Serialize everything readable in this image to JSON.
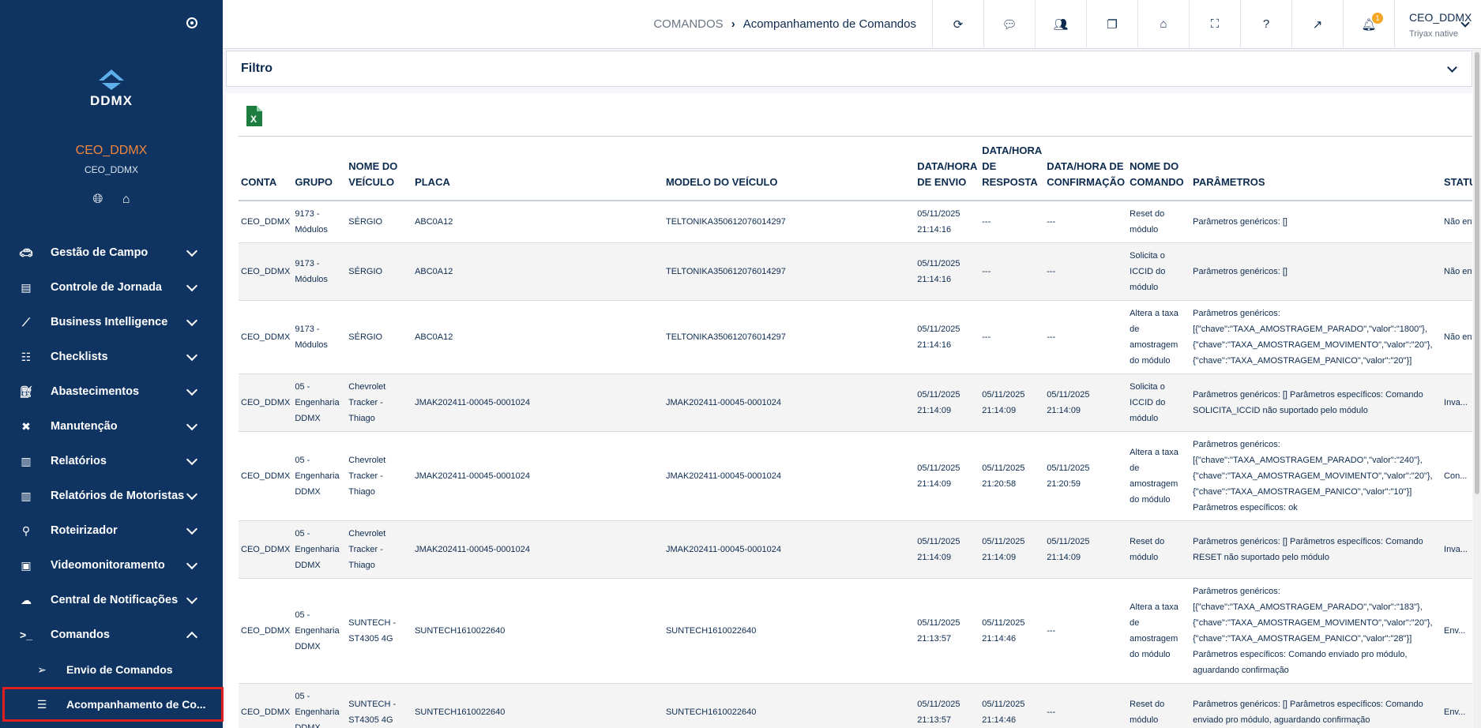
{
  "sidebar": {
    "logo_text": "DDMX",
    "user_name": "CEO_DDMX",
    "user_sub": "CEO_DDMX",
    "menu": [
      {
        "label": "Gestão de Campo",
        "icon": "car-icon"
      },
      {
        "label": "Controle de Jornada",
        "icon": "id-card-icon"
      },
      {
        "label": "Business Intelligence",
        "icon": "chart-line-icon"
      },
      {
        "label": "Checklists",
        "icon": "checklist-icon"
      },
      {
        "label": "Abastecimentos",
        "icon": "fuel-icon"
      },
      {
        "label": "Manutenção",
        "icon": "tools-icon"
      },
      {
        "label": "Relatórios",
        "icon": "report-icon"
      },
      {
        "label": "Relatórios de Motoristas",
        "icon": "driver-report-icon"
      },
      {
        "label": "Roteirizador",
        "icon": "route-icon"
      },
      {
        "label": "Videomonitoramento",
        "icon": "video-icon"
      },
      {
        "label": "Central de Notificações",
        "icon": "notification-car-icon"
      },
      {
        "label": "Comandos",
        "icon": "terminal-icon"
      }
    ],
    "submenu": [
      {
        "label": "Envio de Comandos",
        "icon": "send-icon"
      },
      {
        "label": "Acompanhamento de Co...",
        "icon": "list-check-icon"
      }
    ]
  },
  "topbar": {
    "breadcrumb_root": "COMANDOS",
    "breadcrumb_current": "Acompanhamento de Comandos",
    "notification_count": "1",
    "user_name": "CEO_DDMX",
    "user_sub": "Triyax native"
  },
  "filter": {
    "title": "Filtro"
  },
  "table": {
    "headers": [
      "CONTA",
      "GRUPO",
      "NOME DO VEÍCULO",
      "PLACA",
      "MODELO DO VEÍCULO",
      "DATA/HORA DE ENVIO",
      "DATA/HORA DE RESPOSTA",
      "DATA/HORA DE CONFIRMAÇÃO",
      "NOME DO COMANDO",
      "PARÂMETROS",
      "STATUS ATUAL"
    ],
    "rows": [
      [
        "CEO_DDMX",
        "9173 - Módulos",
        "SÉRGIO",
        "ABC0A12",
        "TELTONIKA350612076014297",
        "05/11/2025 21:14:16",
        "---",
        "---",
        "Reset do módulo",
        "Parâmetros genéricos: []",
        "Não env..."
      ],
      [
        "CEO_DDMX",
        "9173 - Módulos",
        "SÉRGIO",
        "ABC0A12",
        "TELTONIKA350612076014297",
        "05/11/2025 21:14:16",
        "---",
        "---",
        "Solicita o ICCID do módulo",
        "Parâmetros genéricos: []",
        "Não env..."
      ],
      [
        "CEO_DDMX",
        "9173 - Módulos",
        "SÉRGIO",
        "ABC0A12",
        "TELTONIKA350612076014297",
        "05/11/2025 21:14:16",
        "---",
        "---",
        "Altera a taxa de amostragem do módulo",
        "Parâmetros genéricos: [{\"chave\":\"TAXA_AMOSTRAGEM_PARADO\",\"valor\":\"1800\"}, {\"chave\":\"TAXA_AMOSTRAGEM_MOVIMENTO\",\"valor\":\"20\"}, {\"chave\":\"TAXA_AMOSTRAGEM_PANICO\",\"valor\":\"20\"}]",
        "Não env..."
      ],
      [
        "CEO_DDMX",
        "05 - Engenharia DDMX",
        "Chevrolet Tracker - Thiago",
        "JMAK202411-00045-0001024",
        "JMAK202411-00045-0001024",
        "05/11/2025 21:14:09",
        "05/11/2025 21:14:09",
        "05/11/2025 21:14:09",
        "Solicita o ICCID do módulo",
        "Parâmetros genéricos: [] Parâmetros específicos: Comando SOLICITA_ICCID não suportado pelo módulo",
        "Inva..."
      ],
      [
        "CEO_DDMX",
        "05 - Engenharia DDMX",
        "Chevrolet Tracker - Thiago",
        "JMAK202411-00045-0001024",
        "JMAK202411-00045-0001024",
        "05/11/2025 21:14:09",
        "05/11/2025 21:20:58",
        "05/11/2025 21:20:59",
        "Altera a taxa de amostragem do módulo",
        "Parâmetros genéricos: [{\"chave\":\"TAXA_AMOSTRAGEM_PARADO\",\"valor\":\"240\"}, {\"chave\":\"TAXA_AMOSTRAGEM_MOVIMENTO\",\"valor\":\"20\"}, {\"chave\":\"TAXA_AMOSTRAGEM_PANICO\",\"valor\":\"10\"}] Parâmetros específicos: ok",
        "Con..."
      ],
      [
        "CEO_DDMX",
        "05 - Engenharia DDMX",
        "Chevrolet Tracker - Thiago",
        "JMAK202411-00045-0001024",
        "JMAK202411-00045-0001024",
        "05/11/2025 21:14:09",
        "05/11/2025 21:14:09",
        "05/11/2025 21:14:09",
        "Reset do módulo",
        "Parâmetros genéricos: [] Parâmetros específicos: Comando RESET não suportado pelo módulo",
        "Inva..."
      ],
      [
        "CEO_DDMX",
        "05 - Engenharia DDMX",
        "SUNTECH - ST4305 4G",
        "SUNTECH1610022640",
        "SUNTECH1610022640",
        "05/11/2025 21:13:57",
        "05/11/2025 21:14:46",
        "---",
        "Altera a taxa de amostragem do módulo",
        "Parâmetros genéricos: [{\"chave\":\"TAXA_AMOSTRAGEM_PARADO\",\"valor\":\"183\"}, {\"chave\":\"TAXA_AMOSTRAGEM_MOVIMENTO\",\"valor\":\"20\"}, {\"chave\":\"TAXA_AMOSTRAGEM_PANICO\",\"valor\":\"28\"}] Parâmetros específicos: Comando enviado pro módulo, aguardando confirmação",
        "Env..."
      ],
      [
        "CEO_DDMX",
        "05 - Engenharia DDMX",
        "SUNTECH - ST4305 4G",
        "SUNTECH1610022640",
        "SUNTECH1610022640",
        "05/11/2025 21:13:57",
        "05/11/2025 21:14:46",
        "---",
        "Reset do módulo",
        "Parâmetros genéricos: [] Parâmetros específicos: Comando enviado pro módulo, aguardando confirmação",
        "Env..."
      ]
    ]
  },
  "colors": {
    "sidebar_bg": "#0f3461",
    "accent_orange": "#f3873b",
    "active_outline": "#e02020",
    "excel_green": "#1d7d3f"
  }
}
